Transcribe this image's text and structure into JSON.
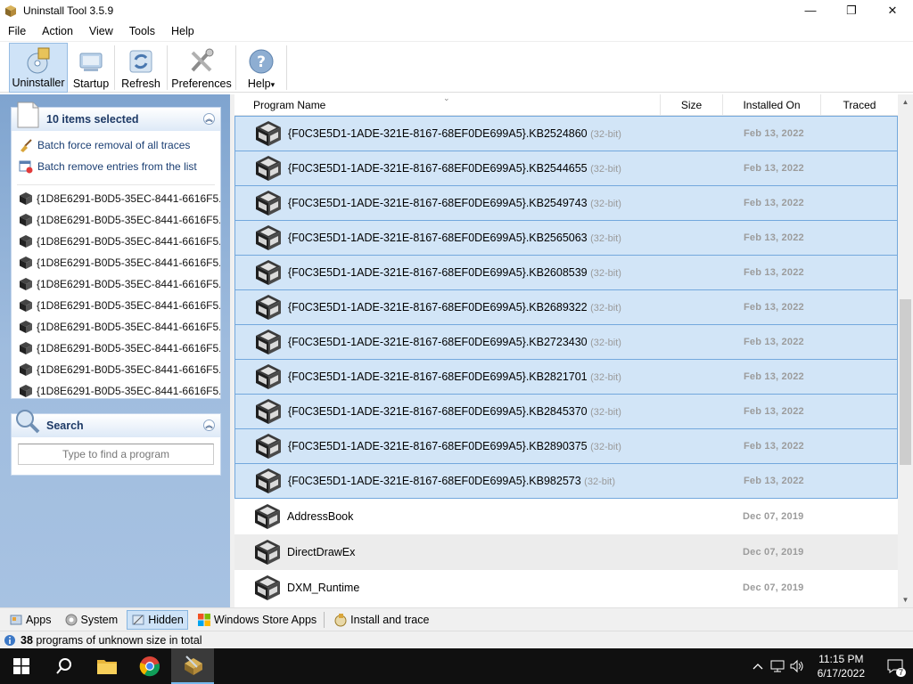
{
  "window": {
    "title": "Uninstall Tool 3.5.9",
    "min_glyph": "—",
    "max_glyph": "❐",
    "close_glyph": "✕"
  },
  "menu": [
    "File",
    "Action",
    "View",
    "Tools",
    "Help"
  ],
  "toolbar": {
    "uninstaller": "Uninstaller",
    "startup": "Startup",
    "refresh": "Refresh",
    "preferences": "Preferences",
    "help": "Help",
    "help_arrow": "▾"
  },
  "selection_panel": {
    "title": "10 items selected",
    "actions": [
      "Batch force removal of all traces",
      "Batch remove entries from the list"
    ],
    "items": [
      "{1D8E6291-B0D5-35EC-8441-6616F5...",
      "{1D8E6291-B0D5-35EC-8441-6616F5...",
      "{1D8E6291-B0D5-35EC-8441-6616F5...",
      "{1D8E6291-B0D5-35EC-8441-6616F5...",
      "{1D8E6291-B0D5-35EC-8441-6616F5...",
      "{1D8E6291-B0D5-35EC-8441-6616F5...",
      "{1D8E6291-B0D5-35EC-8441-6616F5...",
      "{1D8E6291-B0D5-35EC-8441-6616F5...",
      "{1D8E6291-B0D5-35EC-8441-6616F5...",
      "{1D8E6291-B0D5-35EC-8441-6616F5..."
    ]
  },
  "search_panel": {
    "title": "Search",
    "placeholder": "Type to find a program"
  },
  "list": {
    "columns": {
      "name": "Program Name",
      "size": "Size",
      "installed": "Installed On",
      "traced": "Traced"
    },
    "sort_glyph": "⌄",
    "rows": [
      {
        "name": "{F0C3E5D1-1ADE-321E-8167-68EF0DE699A5}.KB2524860",
        "bit": "(32-bit)",
        "date": "Feb 13, 2022",
        "selected": true
      },
      {
        "name": "{F0C3E5D1-1ADE-321E-8167-68EF0DE699A5}.KB2544655",
        "bit": "(32-bit)",
        "date": "Feb 13, 2022",
        "selected": true
      },
      {
        "name": "{F0C3E5D1-1ADE-321E-8167-68EF0DE699A5}.KB2549743",
        "bit": "(32-bit)",
        "date": "Feb 13, 2022",
        "selected": true
      },
      {
        "name": "{F0C3E5D1-1ADE-321E-8167-68EF0DE699A5}.KB2565063",
        "bit": "(32-bit)",
        "date": "Feb 13, 2022",
        "selected": true
      },
      {
        "name": "{F0C3E5D1-1ADE-321E-8167-68EF0DE699A5}.KB2608539",
        "bit": "(32-bit)",
        "date": "Feb 13, 2022",
        "selected": true
      },
      {
        "name": "{F0C3E5D1-1ADE-321E-8167-68EF0DE699A5}.KB2689322",
        "bit": "(32-bit)",
        "date": "Feb 13, 2022",
        "selected": true
      },
      {
        "name": "{F0C3E5D1-1ADE-321E-8167-68EF0DE699A5}.KB2723430",
        "bit": "(32-bit)",
        "date": "Feb 13, 2022",
        "selected": true
      },
      {
        "name": "{F0C3E5D1-1ADE-321E-8167-68EF0DE699A5}.KB2821701",
        "bit": "(32-bit)",
        "date": "Feb 13, 2022",
        "selected": true
      },
      {
        "name": "{F0C3E5D1-1ADE-321E-8167-68EF0DE699A5}.KB2845370",
        "bit": "(32-bit)",
        "date": "Feb 13, 2022",
        "selected": true
      },
      {
        "name": "{F0C3E5D1-1ADE-321E-8167-68EF0DE699A5}.KB2890375",
        "bit": "(32-bit)",
        "date": "Feb 13, 2022",
        "selected": true
      },
      {
        "name": "{F0C3E5D1-1ADE-321E-8167-68EF0DE699A5}.KB982573",
        "bit": "(32-bit)",
        "date": "Feb 13, 2022",
        "selected": true
      },
      {
        "name": "AddressBook",
        "bit": "",
        "date": "Dec 07, 2019",
        "selected": false
      },
      {
        "name": "DirectDrawEx",
        "bit": "",
        "date": "Dec 07, 2019",
        "selected": false,
        "hover": true
      },
      {
        "name": "DXM_Runtime",
        "bit": "",
        "date": "Dec 07, 2019",
        "selected": false
      }
    ]
  },
  "tabs": {
    "apps": "Apps",
    "system": "System",
    "hidden": "Hidden",
    "store": "Windows Store Apps",
    "install": "Install and trace"
  },
  "status": {
    "count": "38",
    "text": " programs of unknown size in total"
  },
  "taskbar": {
    "time": "11:15 PM",
    "date": "6/17/2022",
    "notification_count": "7"
  },
  "colors": {
    "selection_bg": "#d2e5f7",
    "selection_border": "#73a8dd",
    "left_pane_bg": "#9fbcde"
  }
}
